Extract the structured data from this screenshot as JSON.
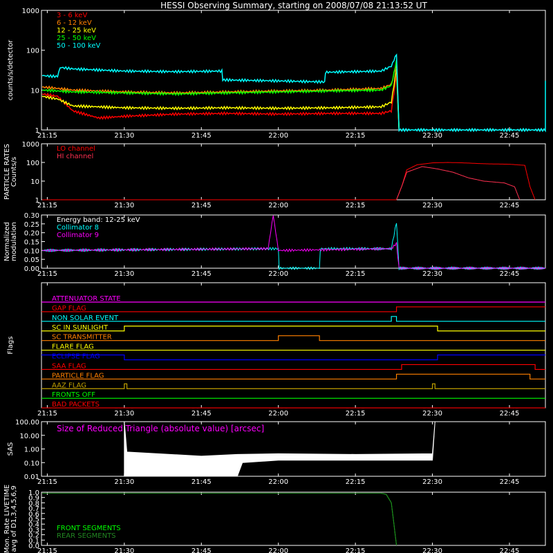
{
  "title": "HESSI Observing Summary, starting on 2008/07/08 21:13:52 UT",
  "colors": {
    "background": "#000000",
    "axes": "#ffffff"
  },
  "time_ticks": [
    "21:15",
    "21:30",
    "21:45",
    "22:00",
    "22:15",
    "22:30",
    "22:45"
  ],
  "chart_data": [
    {
      "id": "count-rates",
      "type": "line",
      "ylabel": "counts/s/detector",
      "yscale": "log",
      "ylim": [
        1,
        1000
      ],
      "yticks": [
        "1",
        "10",
        "100",
        "1000"
      ],
      "xlim": [
        "21:13:52",
        "22:52:00"
      ],
      "legend_placement": "top-left",
      "series": [
        {
          "name": "3 - 6 keV",
          "color": "#ff0000",
          "points": [
            [
              "21:14",
              8
            ],
            [
              "21:17",
              7
            ],
            [
              "21:20",
              3
            ],
            [
              "21:25",
              2
            ],
            [
              "21:30",
              2.2
            ],
            [
              "21:40",
              2.5
            ],
            [
              "21:50",
              2.6
            ],
            [
              "22:00",
              2.5
            ],
            [
              "22:10",
              2.6
            ],
            [
              "22:20",
              2.6
            ],
            [
              "22:22",
              3
            ],
            [
              "22:23",
              25
            ],
            [
              "22:23:30",
              1
            ]
          ]
        },
        {
          "name": "6 - 12 keV",
          "color": "#ff8000",
          "points": [
            [
              "21:14",
              12
            ],
            [
              "21:17",
              11
            ],
            [
              "21:20",
              10
            ],
            [
              "21:25",
              9.5
            ],
            [
              "21:30",
              9
            ],
            [
              "21:40",
              8.5
            ],
            [
              "21:50",
              9
            ],
            [
              "22:00",
              9.5
            ],
            [
              "22:10",
              10
            ],
            [
              "22:20",
              11
            ],
            [
              "22:22",
              14
            ],
            [
              "22:23",
              45
            ],
            [
              "22:23:30",
              1
            ]
          ]
        },
        {
          "name": "12 - 25 keV",
          "color": "#ffff00",
          "points": [
            [
              "21:14",
              7
            ],
            [
              "21:17",
              6
            ],
            [
              "21:20",
              4
            ],
            [
              "21:25",
              3.8
            ],
            [
              "21:30",
              3.6
            ],
            [
              "21:40",
              3.5
            ],
            [
              "21:50",
              3.6
            ],
            [
              "22:00",
              3.5
            ],
            [
              "22:10",
              3.6
            ],
            [
              "22:20",
              3.8
            ],
            [
              "22:22",
              5
            ],
            [
              "22:23",
              35
            ],
            [
              "22:23:30",
              1
            ]
          ]
        },
        {
          "name": "25 - 50 keV",
          "color": "#00ff00",
          "points": [
            [
              "21:14",
              10
            ],
            [
              "21:17",
              9.5
            ],
            [
              "21:20",
              9
            ],
            [
              "21:30",
              8.5
            ],
            [
              "21:40",
              8
            ],
            [
              "21:50",
              8.5
            ],
            [
              "22:00",
              9
            ],
            [
              "22:10",
              9.5
            ],
            [
              "22:20",
              10
            ],
            [
              "22:22",
              13
            ],
            [
              "22:23",
              55
            ],
            [
              "22:23:30",
              1
            ]
          ]
        },
        {
          "name": "50 - 100 keV",
          "color": "#00ffff",
          "points": [
            [
              "21:14",
              23
            ],
            [
              "21:17",
              22
            ],
            [
              "21:17:30",
              37
            ],
            [
              "21:20",
              34
            ],
            [
              "21:30",
              30
            ],
            [
              "21:40",
              29
            ],
            [
              "21:49",
              30
            ],
            [
              "21:49:10",
              18
            ],
            [
              "22:00",
              17
            ],
            [
              "22:09",
              16
            ],
            [
              "22:09:10",
              28
            ],
            [
              "22:20",
              30
            ],
            [
              "22:22",
              40
            ],
            [
              "22:23",
              80
            ],
            [
              "22:23:30",
              1
            ],
            [
              "22:52",
              1
            ],
            [
              "22:52:00",
              18
            ]
          ]
        }
      ]
    },
    {
      "id": "particle-rates",
      "type": "line",
      "ylabel": "PARTICLE RATES Counts/s",
      "yscale": "log",
      "ylim": [
        1,
        1000
      ],
      "yticks": [
        "1",
        "10",
        "100",
        "1000"
      ],
      "legend_placement": "top-left",
      "series": [
        {
          "name": "LO channel",
          "color": "#ff0000",
          "points": [
            [
              "21:14",
              1
            ],
            [
              "22:23",
              1
            ],
            [
              "22:24",
              5
            ],
            [
              "22:25",
              40
            ],
            [
              "22:27",
              75
            ],
            [
              "22:30",
              95
            ],
            [
              "22:33",
              100
            ],
            [
              "22:36",
              95
            ],
            [
              "22:40",
              85
            ],
            [
              "22:45",
              80
            ],
            [
              "22:48",
              70
            ],
            [
              "22:49",
              5
            ],
            [
              "22:50",
              1
            ]
          ]
        },
        {
          "name": "HI channel",
          "color": "#ff3050",
          "points": [
            [
              "22:23",
              1
            ],
            [
              "22:24",
              5
            ],
            [
              "22:25",
              30
            ],
            [
              "22:28",
              60
            ],
            [
              "22:31",
              45
            ],
            [
              "22:34",
              30
            ],
            [
              "22:37",
              15
            ],
            [
              "22:40",
              10
            ],
            [
              "22:44",
              8
            ],
            [
              "22:46",
              5
            ],
            [
              "22:47",
              1
            ]
          ]
        }
      ]
    },
    {
      "id": "modulation",
      "type": "line",
      "ylabel": "Normalized modulation",
      "ylim": [
        0.0,
        0.3
      ],
      "yticks": [
        "0.00",
        "0.05",
        "0.10",
        "0.15",
        "0.20",
        "0.25",
        "0.30"
      ],
      "annotation": "Energy band: 12-25 keV",
      "series": [
        {
          "name": "Collimator 8",
          "color": "#00ffff",
          "points": [
            [
              "21:14",
              0.1
            ],
            [
              "22:00",
              0.11
            ],
            [
              "22:00:10",
              0.0
            ],
            [
              "22:08",
              0.0
            ],
            [
              "22:08:10",
              0.11
            ],
            [
              "22:22",
              0.11
            ],
            [
              "22:23",
              0.26
            ],
            [
              "22:23:30",
              0.0
            ],
            [
              "22:52",
              0.0
            ]
          ]
        },
        {
          "name": "Collimator 9",
          "color": "#ff00ff",
          "points": [
            [
              "21:14",
              0.1
            ],
            [
              "21:58",
              0.11
            ],
            [
              "21:59",
              0.3
            ],
            [
              "22:00",
              0.1
            ],
            [
              "22:22",
              0.11
            ],
            [
              "22:23",
              0.14
            ],
            [
              "22:23:30",
              0.0
            ],
            [
              "22:52",
              0.0
            ]
          ]
        }
      ]
    },
    {
      "id": "flags",
      "type": "line",
      "ylabel": "Flags",
      "series": [
        {
          "name": "ATTENUATOR STATE",
          "color": "#ff00ff",
          "segments": [
            [
              "21:13:52",
              "22:52",
              0
            ]
          ]
        },
        {
          "name": "GAP FLAG",
          "color": "#ff0000",
          "segments": [
            [
              "21:13:52",
              "22:23",
              0
            ],
            [
              "22:23",
              "22:52",
              1
            ]
          ]
        },
        {
          "name": "NON SOLAR EVENT",
          "color": "#00ffff",
          "segments": [
            [
              "21:13:52",
              "22:22",
              0
            ],
            [
              "22:22",
              "22:23",
              1
            ],
            [
              "22:23",
              "22:52",
              0
            ]
          ]
        },
        {
          "name": "SC IN SUNLIGHT",
          "color": "#ffff00",
          "segments": [
            [
              "21:13:52",
              "21:30",
              0
            ],
            [
              "21:30",
              "22:31",
              1
            ],
            [
              "22:31",
              "22:52",
              0
            ]
          ]
        },
        {
          "name": "SC TRANSMITTER",
          "color": "#ff8000",
          "segments": [
            [
              "21:13:52",
              "22:00",
              0
            ],
            [
              "22:00",
              "22:08",
              1
            ],
            [
              "22:08",
              "22:52",
              0
            ]
          ]
        },
        {
          "name": "FLARE FLAG",
          "color": "#ffff00",
          "segments": [
            [
              "21:13:52",
              "22:52",
              0
            ]
          ]
        },
        {
          "name": "ECLIPSE FLAG",
          "color": "#0000ff",
          "segments": [
            [
              "21:13:52",
              "21:30",
              1
            ],
            [
              "21:30",
              "22:31",
              0
            ],
            [
              "22:31",
              "22:52",
              1
            ]
          ]
        },
        {
          "name": "SAA FLAG",
          "color": "#ff0000",
          "segments": [
            [
              "21:13:52",
              "22:24",
              0
            ],
            [
              "22:24",
              "22:50",
              1
            ],
            [
              "22:50",
              "22:52",
              0
            ]
          ]
        },
        {
          "name": "PARTICLE FLAG",
          "color": "#ff8000",
          "segments": [
            [
              "21:13:52",
              "22:23",
              0
            ],
            [
              "22:23",
              "22:49",
              1
            ],
            [
              "22:49",
              "22:52",
              0
            ]
          ]
        },
        {
          "name": "AAZ FLAG",
          "color": "#c0a000",
          "segments": [
            [
              "21:13:52",
              "21:30",
              0
            ],
            [
              "21:30",
              "21:30:30",
              1
            ],
            [
              "21:30:30",
              "22:30",
              0
            ],
            [
              "22:30",
              "22:30:30",
              1
            ],
            [
              "22:30:30",
              "22:52",
              0
            ]
          ]
        },
        {
          "name": "FRONTS OFF",
          "color": "#00ff00",
          "segments": [
            [
              "21:13:52",
              "22:52",
              0
            ]
          ]
        },
        {
          "name": "BAD PACKETS",
          "color": "#ff0000",
          "segments": [
            [
              "21:13:52",
              "22:52",
              0
            ]
          ]
        }
      ]
    },
    {
      "id": "sas",
      "type": "area",
      "ylabel": "SAS",
      "yscale": "log",
      "ylim": [
        0.01,
        100
      ],
      "yticks": [
        "0.01",
        "0.10",
        "1.00",
        "10.00",
        "100.00"
      ],
      "annotation": "Size of Reduced Triangle (absolute value) [arcsec]",
      "series": [
        {
          "name": "Size of Reduced Triangle",
          "color": "#ffffff",
          "upper": [
            [
              "21:30",
              100
            ],
            [
              "21:30:30",
              0.6
            ],
            [
              "21:45",
              0.3
            ],
            [
              "21:52",
              0.4
            ],
            [
              "22:00",
              0.45
            ],
            [
              "22:15",
              0.4
            ],
            [
              "22:30",
              0.45
            ],
            [
              "22:30:30",
              100
            ]
          ],
          "lower": [
            [
              "21:30",
              0.01
            ],
            [
              "21:52",
              0.01
            ],
            [
              "21:53",
              0.1
            ],
            [
              "22:00",
              0.15
            ],
            [
              "22:15",
              0.15
            ],
            [
              "22:30",
              0.15
            ]
          ]
        }
      ]
    },
    {
      "id": "livetime",
      "type": "line",
      "ylabel": "Mon. Rate LIVETIME avg of D1,3,4,5,6,9",
      "ylim": [
        0.0,
        1.0
      ],
      "yticks": [
        "0.0",
        "0.1",
        "0.2",
        "0.3",
        "0.4",
        "0.5",
        "0.6",
        "0.7",
        "0.8",
        "0.9",
        "1.0"
      ],
      "legend_placement": "bottom-left",
      "series": [
        {
          "name": "FRONT SEGMENTS",
          "color": "#00ff00",
          "points": [
            [
              "21:14",
              0.98
            ],
            [
              "22:20",
              0.98
            ],
            [
              "22:21",
              0.96
            ],
            [
              "22:22",
              0.8
            ],
            [
              "22:23",
              0.0
            ]
          ]
        },
        {
          "name": "REAR SEGMENTS",
          "color": "#228822",
          "points": [
            [
              "21:14",
              0.98
            ],
            [
              "22:20",
              0.98
            ],
            [
              "22:21",
              0.96
            ],
            [
              "22:22",
              0.8
            ],
            [
              "22:23",
              0.0
            ]
          ]
        }
      ]
    }
  ]
}
